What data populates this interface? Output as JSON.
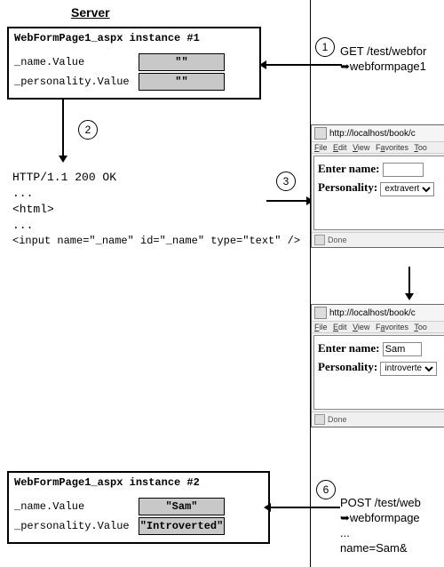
{
  "heading": "Server",
  "instance1": {
    "title": "WebFormPage1_aspx instance #1",
    "name_label": "_name.Value",
    "name_value": "\"\"",
    "personality_label": "_personality.Value",
    "personality_value": "\"\""
  },
  "instance2": {
    "title": "WebFormPage1_aspx instance #2",
    "name_label": "_name.Value",
    "name_value": "\"Sam\"",
    "personality_label": "_personality.Value",
    "personality_value": "\"Introverted\""
  },
  "steps": {
    "1": "1",
    "2": "2",
    "3": "3",
    "6": "6"
  },
  "step1_text": {
    "l1": "GET /test/webfor",
    "l2": "➥webformpage1"
  },
  "step6_text": {
    "l1": "POST /test/web",
    "l2": "➥webformpage",
    "l3": "...",
    "l4": "  name=Sam&"
  },
  "response": {
    "l1": "HTTP/1.1 200 OK",
    "l2": "...",
    "l3": "<html>",
    "l4": "...",
    "l5": "<input name=\"_name\" id=\"_name\" type=\"text\" />"
  },
  "browser": {
    "url": "http://localhost/book/c",
    "menu": [
      "File",
      "Edit",
      "View",
      "Favorites",
      "Too"
    ],
    "status": "Done",
    "labels": {
      "name": "Enter name:",
      "personality": "Personality:"
    },
    "win1": {
      "name_value": "",
      "personality_value": "extravert"
    },
    "win2": {
      "name_value": "Sam",
      "personality_value": "introverte"
    }
  }
}
